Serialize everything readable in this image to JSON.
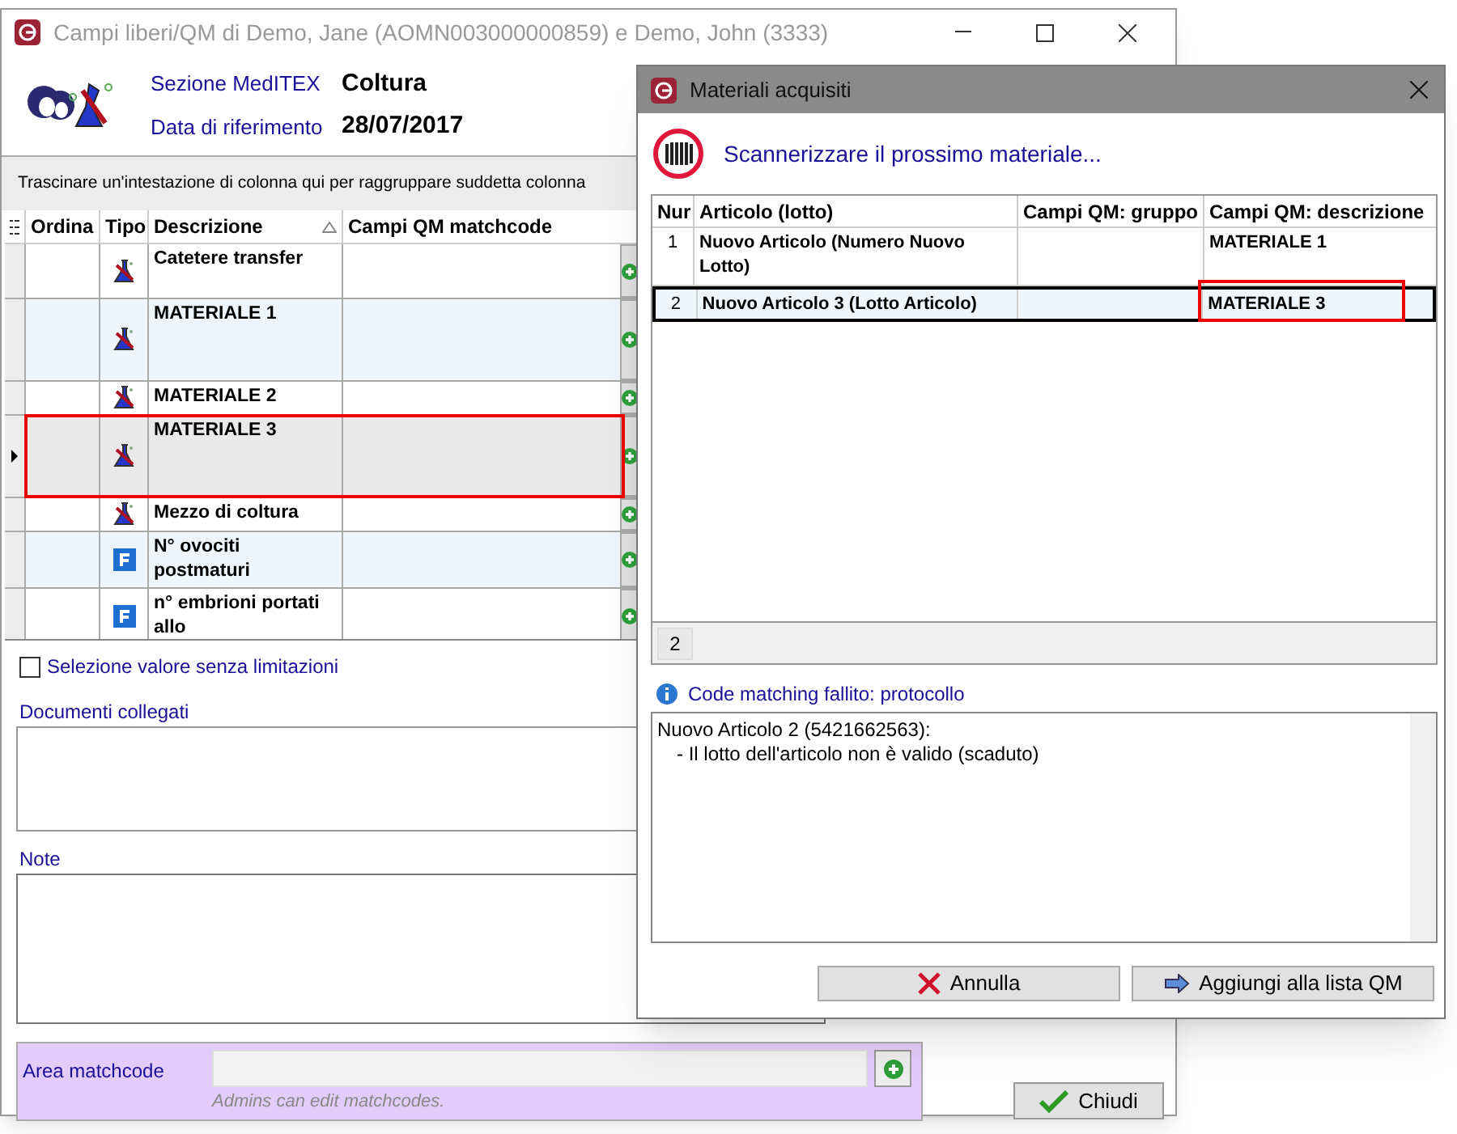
{
  "main_window": {
    "title": "Campi liberi/QM di Demo, Jane (AOMN003000000859) e Demo, John (3333)",
    "header": [
      {
        "label": "Sezione MedITEX",
        "value": "Coltura"
      },
      {
        "label": "Data di riferimento",
        "value": "28/07/2017"
      }
    ],
    "group_hint": "Trascinare un'intestazione di colonna qui per raggruppare suddetta colonna",
    "table": {
      "columns": [
        "Ordina",
        "Tipo",
        "Descrizione",
        "Campi QM matchcode"
      ],
      "rows": [
        {
          "kind": "material",
          "description": "Catetere transfer",
          "selected": false
        },
        {
          "kind": "material",
          "description": "MATERIALE 1",
          "selected": false
        },
        {
          "kind": "material",
          "description": "MATERIALE 2",
          "selected": false
        },
        {
          "kind": "material",
          "description": "MATERIALE 3",
          "selected": true
        },
        {
          "kind": "material",
          "description": "Mezzo di coltura",
          "selected": false
        },
        {
          "kind": "field",
          "description": "N° ovociti postmaturi",
          "selected": false
        },
        {
          "kind": "field",
          "description": "n° embrioni portati allo",
          "selected": false
        }
      ]
    },
    "unrestricted": {
      "label": "Selezione valore senza limitazioni",
      "checked": false
    },
    "documents_label": "Documenti collegati",
    "notes_label": "Note",
    "matchcode": {
      "label": "Area matchcode",
      "hint": "Admins can edit matchcodes."
    },
    "close_button": "Chiudi"
  },
  "dialog": {
    "title": "Materiali acquisiti",
    "prompt": "Scannerizzare il prossimo materiale...",
    "table": {
      "columns": [
        "Nur",
        "Articolo (lotto)",
        "Campi QM: gruppo",
        "Campi QM: descrizione"
      ],
      "rows": [
        {
          "num": "1",
          "article": "Nuovo Articolo (Numero Nuovo Lotto)",
          "group": "",
          "description": "MATERIALE 1",
          "selected": false
        },
        {
          "num": "2",
          "article": "Nuovo Articolo 3 (Lotto Articolo)",
          "group": "",
          "description": "MATERIALE 3",
          "selected": true
        }
      ],
      "count": "2"
    },
    "log_title": "Code matching fallito: protocollo",
    "log_lines": [
      "Nuovo Articolo 2 (5421662563):",
      "- Il lotto dell'articolo non è valido (scaduto)"
    ],
    "buttons": [
      {
        "kind": "cancel",
        "label": "Annulla"
      },
      {
        "kind": "add",
        "label": "Aggiungi alla lista QM"
      }
    ]
  }
}
